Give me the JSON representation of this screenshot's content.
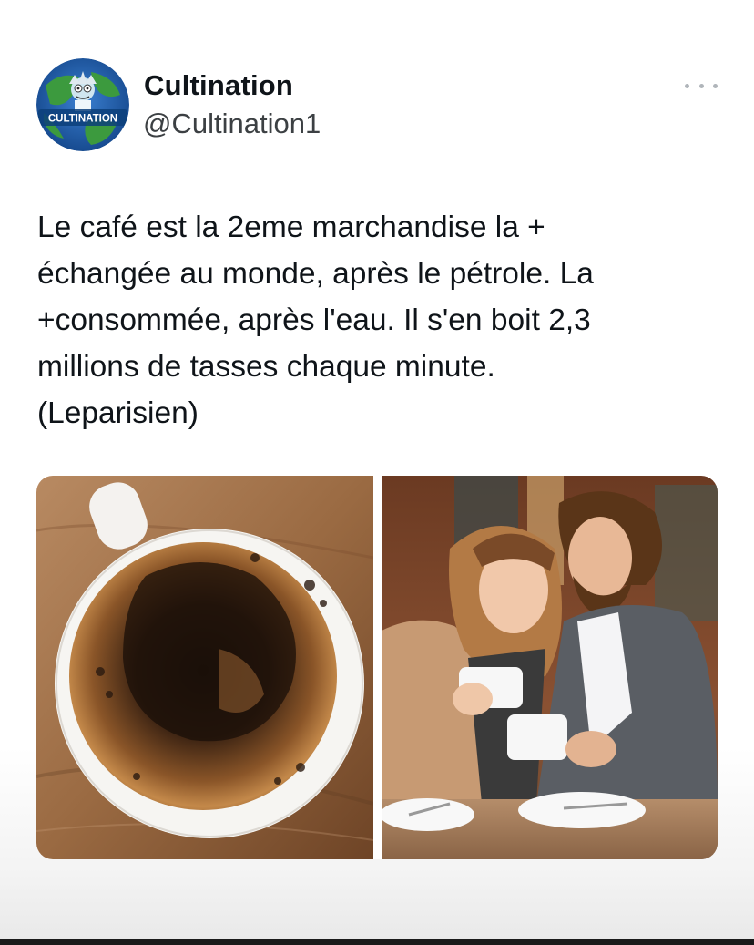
{
  "post": {
    "author_name": "Cultination",
    "author_handle": "@Cultination1",
    "avatar_label": "CULTINATION",
    "text_lines": [
      "Le café est la 2eme marchandise la +",
      "échangée au monde, après le pétrole. La",
      "+consommée, après l'eau. Il s'en boit 2,3",
      "millions de tasses chaque minute.",
      "(Leparisien)"
    ],
    "more_icon": "ellipsis-icon",
    "media": [
      {
        "name": "coffee-cup-photo"
      },
      {
        "name": "couple-drinking-coffee-photo"
      }
    ]
  },
  "colors": {
    "text": "#0f1419",
    "handle": "#3c4043",
    "avatar_ocean": "#1f5fa8",
    "avatar_land": "#2f8a3a",
    "coffee_crema": "#b57a3c",
    "wood": "#9a6a42"
  }
}
